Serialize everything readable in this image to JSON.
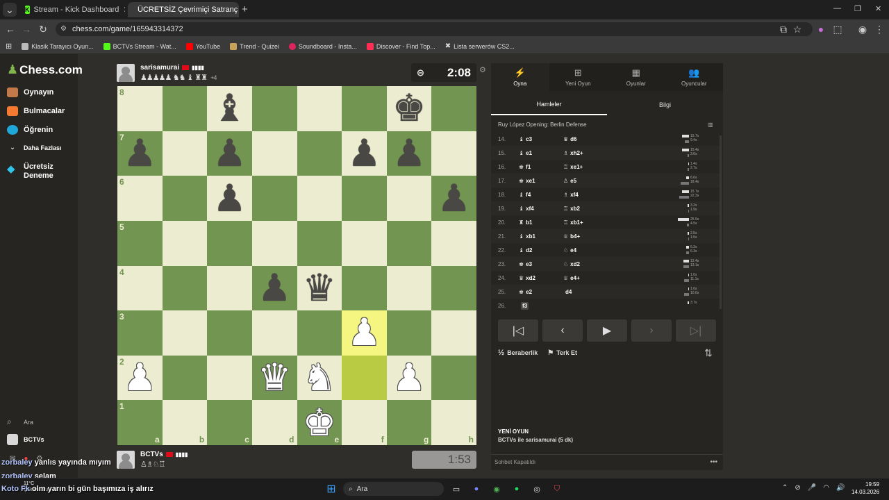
{
  "browser": {
    "tabs": [
      {
        "label": "Stream - Kick Dashboard",
        "active": false
      },
      {
        "label": "ÜCRETSİZ Çevrimiçi Satranç Oy...",
        "active": true
      }
    ],
    "url": "chess.com/game/165943314372",
    "bookmarks": [
      {
        "label": "Klasik Tarayıcı Oyun...",
        "color": "#bbbbbb"
      },
      {
        "label": "BCTVs Stream - Wat...",
        "color": "#53fc18"
      },
      {
        "label": "YouTube",
        "color": "#ff0000"
      },
      {
        "label": "Trend - Quizei",
        "color": "#c9a25a"
      },
      {
        "label": "Soundboard - Insta...",
        "color": "#e0245e"
      },
      {
        "label": "Discover - Find Top...",
        "color": "#ff2d55"
      },
      {
        "label": "Lista serwerów CS2...",
        "color": "#ffffff"
      }
    ]
  },
  "sidebar": {
    "logo": "Chess.com",
    "items": [
      {
        "label": "Oynayın",
        "icon": "pawn-play-icon",
        "color": "#c27a4a"
      },
      {
        "label": "Bulmacalar",
        "icon": "puzzle-icon",
        "color": "#f37a30"
      },
      {
        "label": "Öğrenin",
        "icon": "learn-icon",
        "color": "#1fa7d9"
      },
      {
        "label": "Daha Fazlası",
        "icon": "chevron-down-icon",
        "color": "#cccccc"
      },
      {
        "label": "Ücretsiz Deneme",
        "icon": "diamond-icon",
        "color": "#2ec5ea"
      }
    ],
    "search_label": "Ara",
    "user_label": "BCTVs"
  },
  "game": {
    "top_player": {
      "name": "sarisamurai",
      "captured": "♟♟♟♟♟ ♞♞ ♝ ♜♜",
      "captured_extra": "+4"
    },
    "bottom_player": {
      "name": "BCTVs",
      "captured": "♙♗♘♖"
    },
    "top_clock": "2:08",
    "bottom_clock": "1:53",
    "files": [
      "a",
      "b",
      "c",
      "d",
      "e",
      "f",
      "g",
      "h"
    ],
    "ranks": [
      "8",
      "7",
      "6",
      "5",
      "4",
      "3",
      "2",
      "1"
    ],
    "position": [
      [
        "",
        "",
        "b",
        "",
        "",
        "",
        "k",
        ""
      ],
      [
        "p",
        "",
        "p",
        "",
        "",
        "p",
        "p",
        ""
      ],
      [
        "",
        "",
        "p",
        "",
        "",
        "",
        "",
        "p"
      ],
      [
        "",
        "",
        "",
        "",
        "",
        "",
        "",
        ""
      ],
      [
        "",
        "",
        "",
        "p",
        "q",
        "",
        "",
        ""
      ],
      [
        "",
        "",
        "",
        "",
        "",
        "P",
        "",
        ""
      ],
      [
        "P",
        "",
        "",
        "Q",
        "N",
        "",
        "P",
        ""
      ],
      [
        "",
        "",
        "",
        "",
        "K",
        "",
        "",
        ""
      ]
    ],
    "highlight_squares": [
      "f3",
      "f2"
    ]
  },
  "panel": {
    "tabs": [
      {
        "label": "Oyna",
        "icon": "bolt-icon",
        "active": true
      },
      {
        "label": "Yeni Oyun",
        "icon": "plus-icon",
        "active": false
      },
      {
        "label": "Oyunlar",
        "icon": "board-icon",
        "active": false
      },
      {
        "label": "Oyuncular",
        "icon": "players-icon",
        "active": false
      }
    ],
    "subtabs": [
      {
        "label": "Hamleler",
        "active": true
      },
      {
        "label": "Bilgi",
        "active": false
      }
    ],
    "opening": "Ruy López Opening: Berlin Defense",
    "moves": [
      {
        "n": "14.",
        "w_icon": "♝",
        "w": "c3",
        "b_icon": "♛",
        "b": "d6",
        "tw": "15.7s",
        "tb": "9.4s",
        "bw": 0.62,
        "bb": 0.37
      },
      {
        "n": "15.",
        "w_icon": "♝",
        "w": "e1",
        "b_icon": "♗",
        "b": "xh2+",
        "tw": "15.4s",
        "tb": "3.6s",
        "bw": 0.6,
        "bb": 0.14
      },
      {
        "n": "16.",
        "w_icon": "♚",
        "w": "f1",
        "b_icon": "♖",
        "b": "xe1+",
        "tw": "1.4s",
        "tb": "2.7s",
        "bw": 0.06,
        "bb": 0.11
      },
      {
        "n": "17.",
        "w_icon": "♚",
        "w": "xe1",
        "b_icon": "♙",
        "b": "e5",
        "tw": "6.6s",
        "tb": "18.4s",
        "bw": 0.26,
        "bb": 0.72
      },
      {
        "n": "18.",
        "w_icon": "♝",
        "w": "f4",
        "b_icon": "♗",
        "b": "xf4",
        "tw": "15.7s",
        "tb": "22.3s",
        "bw": 0.62,
        "bb": 0.87
      },
      {
        "n": "19.",
        "w_icon": "♝",
        "w": "xf4",
        "b_icon": "♖",
        "b": "xb2",
        "tw": "3.2s",
        "tb": "1.9s",
        "bw": 0.13,
        "bb": 0.07
      },
      {
        "n": "20.",
        "w_icon": "♜",
        "w": "b1",
        "b_icon": "♖",
        "b": "xb1+",
        "tw": "25.5s",
        "tb": "4.5s",
        "bw": 1.0,
        "bb": 0.18
      },
      {
        "n": "21.",
        "w_icon": "♝",
        "w": "xb1",
        "b_icon": "♕",
        "b": "b4+",
        "tw": "2.5s",
        "tb": "1.5s",
        "bw": 0.1,
        "bb": 0.06
      },
      {
        "n": "22.",
        "w_icon": "♝",
        "w": "d2",
        "b_icon": "♘",
        "b": "e4",
        "tw": "6.3s",
        "tb": "6.3s",
        "bw": 0.25,
        "bb": 0.25
      },
      {
        "n": "23.",
        "w_icon": "♚",
        "w": "e3",
        "b_icon": "♘",
        "b": "xd2",
        "tw": "12.4s",
        "tb": "13.1s",
        "bw": 0.49,
        "bb": 0.51
      },
      {
        "n": "24.",
        "w_icon": "♛",
        "w": "xd2",
        "b_icon": "♕",
        "b": "e4+",
        "tw": "1.0s",
        "tb": "11.1s",
        "bw": 0.04,
        "bb": 0.44
      },
      {
        "n": "25.",
        "w_icon": "♚",
        "w": "e2",
        "b_icon": "",
        "b": "d4",
        "tw": "1.6s",
        "tb": "10.6s",
        "bw": 0.06,
        "bb": 0.42
      },
      {
        "n": "26.",
        "w_icon": "",
        "w": "f3",
        "b_icon": "",
        "b": "",
        "tw": "3.7s",
        "tb": "",
        "bw": 0.15,
        "bb": 0
      }
    ],
    "draw_label": "Beraberlik",
    "draw_icon": "½",
    "resign_label": "Terk Et",
    "new_game_title": "YENİ OYUN",
    "new_game_desc": "BCTVs ile sarisamurai (5 dk)",
    "chat_disabled": "Sohbet Kapatıldı"
  },
  "chat_overlay": [
    {
      "user": "zorbaley",
      "msg": "yanlıs yayında mıyım"
    },
    {
      "user": "zorbaley",
      "msg": "selam"
    },
    {
      "user": "Koto Fk",
      "msg": "olm yarın bi gün başımıza iş alırız"
    }
  ],
  "taskbar": {
    "search_label": "Ara",
    "weather": "11°C",
    "weather_desc": "Çok bulutlu",
    "time": "19:59",
    "date": "14.03.2026"
  }
}
